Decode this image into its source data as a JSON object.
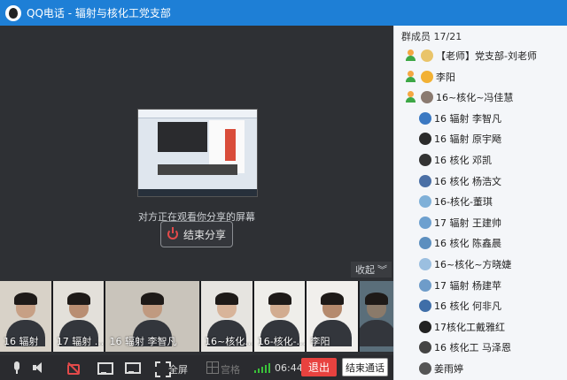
{
  "window": {
    "title": "QQ电话 - 辐射与核化工党支部"
  },
  "stage": {
    "share_status": "对方正在观看你分享的屏幕",
    "end_share_label": "结束分享",
    "collapse_label": "收起"
  },
  "thumbnails": [
    {
      "label": "16 辐射",
      "skin": "#c7a085",
      "bg": "#d8d2c8"
    },
    {
      "label": "17 辐射 ...",
      "skin": "#b98e72",
      "bg": "#e3e0da"
    },
    {
      "label": "16 辐射 李智凡",
      "skin": "#c09a80",
      "bg": "#c9c4bb"
    },
    {
      "label": "16~核化...",
      "skin": "#d8b49a",
      "bg": "#e6e4e0"
    },
    {
      "label": "16-核化-...",
      "skin": "#d2ac90",
      "bg": "#efeeea"
    },
    {
      "label": "李阳",
      "skin": "#b58a6d",
      "bg": "#f1efec"
    },
    {
      "label": "",
      "skin": "#8a7a6a",
      "bg": "#5a6e7a"
    }
  ],
  "toolbar": {
    "fullscreen_label": "全屏",
    "grid_label": "宫格",
    "duration": "06:44",
    "exit_label": "退出",
    "end_call_label": "结束通话"
  },
  "sidebar": {
    "count_label": "群成员 17/21",
    "members": [
      {
        "name": "【老师】党支部-刘老师",
        "speaking": true,
        "avatar": "#e9c46a"
      },
      {
        "name": "李阳",
        "speaking": true,
        "avatar": "#f2b134"
      },
      {
        "name": "16~核化~冯佳慧",
        "speaking": true,
        "avatar": "#8a7a70"
      },
      {
        "name": "16 辐射 李智凡",
        "speaking": false,
        "avatar": "#3a78c2"
      },
      {
        "name": "16 辐射 原宇飏",
        "speaking": false,
        "avatar": "#2b2b2b"
      },
      {
        "name": "16 核化 邓凯",
        "speaking": false,
        "avatar": "#333333"
      },
      {
        "name": "16 核化 杨浩文",
        "speaking": false,
        "avatar": "#4a6fa5"
      },
      {
        "name": "16-核化-董琪",
        "speaking": false,
        "avatar": "#7fb0d8"
      },
      {
        "name": "17 辐射 王建帅",
        "speaking": false,
        "avatar": "#6da0cf"
      },
      {
        "name": "16 核化 陈鑫晨",
        "speaking": false,
        "avatar": "#5c8fbf"
      },
      {
        "name": "16~核化~方晓婕",
        "speaking": false,
        "avatar": "#9bbfe0"
      },
      {
        "name": "17 辐射 杨建苹",
        "speaking": false,
        "avatar": "#6e9cc9"
      },
      {
        "name": "16 核化 何非凡",
        "speaking": false,
        "avatar": "#3f6ea8"
      },
      {
        "name": "17核化工戴雅红",
        "speaking": false,
        "avatar": "#222222"
      },
      {
        "name": "16 核化工 马泽恩",
        "speaking": false,
        "avatar": "#444444"
      },
      {
        "name": "姜雨婷",
        "speaking": false,
        "avatar": "#555555"
      }
    ]
  }
}
